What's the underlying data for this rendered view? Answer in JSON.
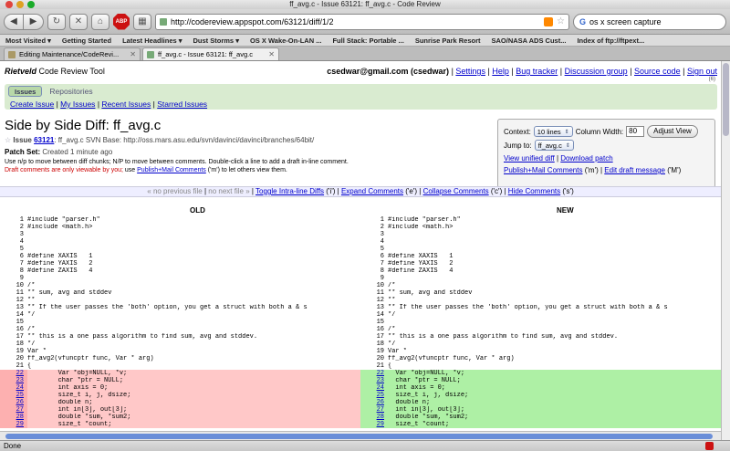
{
  "window": {
    "title": "ff_avg.c - Issue 63121: ff_avg.c - Code Review"
  },
  "toolbar": {
    "url": "http://codereview.appspot.com/63121/diff/1/2",
    "search_value": "os x screen capture",
    "back_icon": "back-arrow-icon",
    "forward_icon": "forward-arrow-icon",
    "reload_glyph": "↻",
    "stop_glyph": "✕",
    "home_glyph": "⌂",
    "abp_label": "ABP"
  },
  "bookmarks": [
    "Most Visited ▾",
    "Getting Started",
    "Latest Headlines ▾",
    "Dust Storms ▾",
    "OS X Wake-On-LAN ...",
    "Full Stack: Portable ...",
    "Sunrise Park Resort",
    "SAO/NASA ADS Cust...",
    "Index of ftp://ftpext..."
  ],
  "tabs": [
    {
      "label": "Editing Maintenance/CodeRevi...",
      "active": false
    },
    {
      "label": "ff_avg.c - Issue 63121: ff_avg.c",
      "active": true
    }
  ],
  "header": {
    "brand_italic": "Rietveld",
    "brand_rest": " Code Review Tool"
  },
  "user": {
    "email": "csedwar@gmail.com (csedwar)",
    "links": [
      "Settings",
      "Help",
      "Bug tracker",
      "Discussion group",
      "Source code",
      "Sign out"
    ],
    "counter": "(6)"
  },
  "issue_tabs": [
    "Issues",
    "Repositories"
  ],
  "issue_links": [
    "Create Issue",
    "My Issues",
    "Recent Issues",
    "Starred Issues"
  ],
  "page": {
    "title": "Side by Side Diff: ff_avg.c",
    "issue_prefix": "Issue",
    "issue_number": "63121",
    "issue_rest": ": ff_avg.c SVN Base: http://oss.mars.asu.edu/svn/davinci/davinci/branches/64bit/",
    "patch_label": "Patch Set:",
    "patch_value": " Created 1 minute ago",
    "hint": "Use n/p to move between diff chunks; N/P to move between comments. Double-click a line to add a draft in-line comment.",
    "draft_red": "Draft comments are only viewable by you;",
    "draft_use": " use ",
    "draft_link": "Publish+Mail Comments",
    "draft_rest": " ('m') to let others view them."
  },
  "context": {
    "context_label": "Context:",
    "context_value": "10 lines",
    "width_label": "Column Width:",
    "width_value": "80",
    "adjust_label": "Adjust View",
    "jump_label": "Jump to:",
    "jump_value": "ff_avg.c",
    "unified": "View unified diff",
    "download": "Download patch",
    "publish": "Publish+Mail Comments",
    "publish_key": " ('m')",
    "draft_msg": "Edit draft message",
    "draft_key": " ('M')"
  },
  "diffnav": {
    "prev": "« no previous file",
    "next": "no next file »",
    "toggle": "Toggle Intra-line Diffs",
    "toggle_key": " ('i')",
    "expand": "Expand Comments",
    "expand_key": " ('e')",
    "collapse": "Collapse Comments",
    "collapse_key": " ('c')",
    "hide": "Hide Comments",
    "hide_key": " ('s')"
  },
  "diff": {
    "old_label": "OLD",
    "new_label": "NEW",
    "rows": [
      {
        "n": "1",
        "old": "#include \"parser.h\"",
        "new": "#include \"parser.h\"",
        "changed": false
      },
      {
        "n": "2",
        "old": "#include <math.h>",
        "new": "#include <math.h>",
        "changed": false
      },
      {
        "n": "3",
        "old": "",
        "new": "",
        "changed": false
      },
      {
        "n": "4",
        "old": "",
        "new": "",
        "changed": false
      },
      {
        "n": "5",
        "old": "",
        "new": "",
        "changed": false
      },
      {
        "n": "6",
        "old": "#define XAXIS   1",
        "new": "#define XAXIS   1",
        "changed": false
      },
      {
        "n": "7",
        "old": "#define YAXIS   2",
        "new": "#define YAXIS   2",
        "changed": false
      },
      {
        "n": "8",
        "old": "#define ZAXIS   4",
        "new": "#define ZAXIS   4",
        "changed": false
      },
      {
        "n": "9",
        "old": "",
        "new": "",
        "changed": false
      },
      {
        "n": "10",
        "old": "/*",
        "new": "/*",
        "changed": false
      },
      {
        "n": "11",
        "old": "** sum, avg and stddev",
        "new": "** sum, avg and stddev",
        "changed": false
      },
      {
        "n": "12",
        "old": "**",
        "new": "**",
        "changed": false
      },
      {
        "n": "13",
        "old": "** If the user passes the 'both' option, you get a struct with both a & s",
        "new": "** If the user passes the 'both' option, you get a struct with both a & s",
        "changed": false
      },
      {
        "n": "14",
        "old": "*/",
        "new": "*/",
        "changed": false
      },
      {
        "n": "15",
        "old": "",
        "new": "",
        "changed": false
      },
      {
        "n": "16",
        "old": "/*",
        "new": "/*",
        "changed": false
      },
      {
        "n": "17",
        "old": "** this is a one pass algorithm to find sum, avg and stddev.",
        "new": "** this is a one pass algorithm to find sum, avg and stddev.",
        "changed": false
      },
      {
        "n": "18",
        "old": "*/",
        "new": "*/",
        "changed": false
      },
      {
        "n": "19",
        "old": "Var *",
        "new": "Var *",
        "changed": false
      },
      {
        "n": "20",
        "old": "ff_avg2(vfuncptr func, Var * arg)",
        "new": "ff_avg2(vfuncptr func, Var * arg)",
        "changed": false
      },
      {
        "n": "21",
        "old": "{",
        "new": "{",
        "changed": false
      },
      {
        "n": "22",
        "old": "        Var *obj=NULL, *v;",
        "new": "  Var *obj=NULL, *v;",
        "changed": true
      },
      {
        "n": "23",
        "old": "        char *ptr = NULL;",
        "new": "  char *ptr = NULL;",
        "changed": true
      },
      {
        "n": "24",
        "old": "        int axis = 0;",
        "new": "  int axis = 0;",
        "changed": true
      },
      {
        "n": "25",
        "old": "        size_t i, j, dsize;",
        "new": "  size_t i, j, dsize;",
        "changed": true
      },
      {
        "n": "26",
        "old": "        double n;",
        "new": "  double n;",
        "changed": true
      },
      {
        "n": "27",
        "old": "        int in[3], out[3];",
        "new": "  int in[3], out[3];",
        "changed": true
      },
      {
        "n": "28",
        "old": "        double *sum, *sum2;",
        "new": "  double *sum, *sum2;",
        "changed": true
      },
      {
        "n": "29",
        "old": "        size_t *count;",
        "new": "  size_t *count;",
        "changed": true
      }
    ]
  },
  "status": {
    "text": "Done"
  }
}
